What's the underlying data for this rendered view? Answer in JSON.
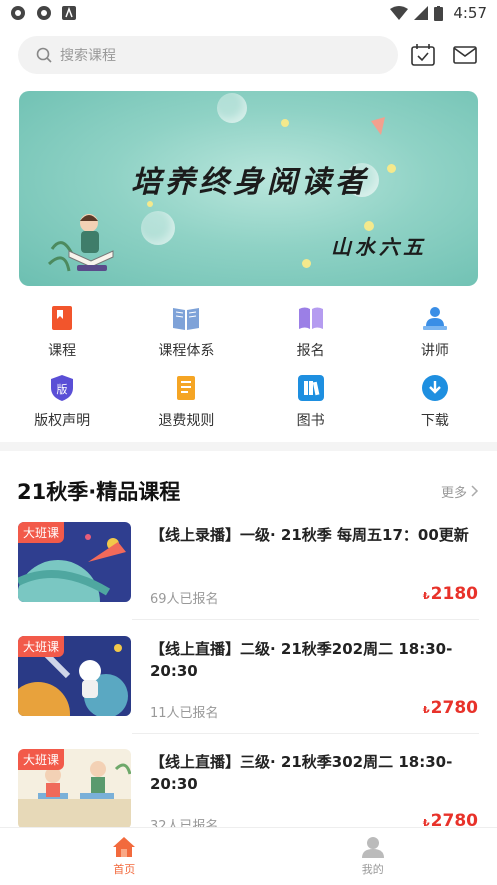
{
  "status_bar": {
    "time": "4:57"
  },
  "search": {
    "placeholder": "搜索课程"
  },
  "banner": {
    "title": "培养终身阅读者",
    "signature": "山水六五"
  },
  "menu": [
    {
      "label": "课程",
      "icon": "course-book-icon",
      "color": "#f2552c"
    },
    {
      "label": "课程体系",
      "icon": "open-book-icon",
      "color": "#7ea2d8"
    },
    {
      "label": "报名",
      "icon": "signup-book-icon",
      "color": "#9b7fe6"
    },
    {
      "label": "讲师",
      "icon": "lecturer-icon",
      "color": "#3a8ee6"
    },
    {
      "label": "版权声明",
      "icon": "copyright-shield-icon",
      "color": "#5a4fd6"
    },
    {
      "label": "退费规则",
      "icon": "refund-doc-icon",
      "color": "#f5a524"
    },
    {
      "label": "图书",
      "icon": "books-icon",
      "color": "#1e8fe0"
    },
    {
      "label": "下载",
      "icon": "download-icon",
      "color": "#1e8fe0"
    }
  ],
  "section": {
    "title": "21秋季·精品课程",
    "more": "更多"
  },
  "courses": [
    {
      "tag": "大班课",
      "title": "【线上录播】一级· 21秋季 每周五17：00更新",
      "enrolled": "69人已报名",
      "currency": "₺",
      "price": "2180"
    },
    {
      "tag": "大班课",
      "title": "【线上直播】二级· 21秋季202周二 18:30-20:30",
      "enrolled": "11人已报名",
      "currency": "₺",
      "price": "2780"
    },
    {
      "tag": "大班课",
      "title": "【线上直播】三级· 21秋季302周二 18:30-20:30",
      "enrolled": "32人已报名",
      "currency": "₺",
      "price": "2780"
    }
  ],
  "tabbar": {
    "home": "首页",
    "mine": "我的"
  },
  "colors": {
    "accent": "#f26a3d",
    "price": "#e8322a",
    "banner": "#8fd2c5"
  }
}
